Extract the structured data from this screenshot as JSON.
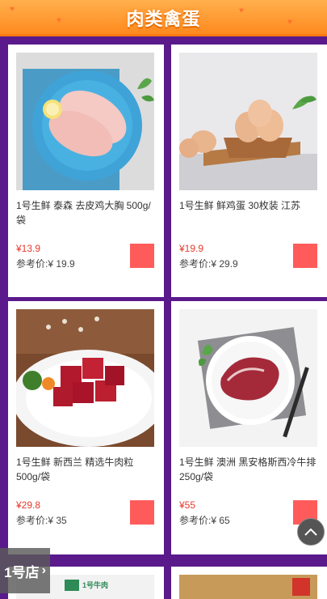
{
  "header": {
    "title": "肉类禽蛋"
  },
  "products": [
    {
      "name": "1号生鲜 泰森 去皮鸡大胸 500g/袋",
      "price": "¥13.9",
      "ref_price": "参考价:¥ 19.9",
      "image": "chicken-breast-image"
    },
    {
      "name": "1号生鲜 鲜鸡蛋 30枚装 江苏",
      "price": "¥19.9",
      "ref_price": "参考价:¥ 29.9",
      "image": "eggs-image"
    },
    {
      "name": "1号生鲜 新西兰 精选牛肉粒 500g/袋",
      "price": "¥29.8",
      "ref_price": "参考价:¥ 35",
      "image": "beef-cubes-image"
    },
    {
      "name": "1号生鲜 澳洲 黑安格斯西冷牛排 250g/袋",
      "price": "¥55",
      "ref_price": "参考价:¥ 65",
      "image": "sirloin-steak-image"
    }
  ],
  "bottom_thumbs": [
    {
      "label": "1号牛肉"
    },
    {
      "label": ""
    }
  ],
  "floating_logo": {
    "label": "1号店",
    "icon": "chevron-right-icon"
  },
  "colors": {
    "header": "#ff8a1f",
    "background": "#5a1a8c",
    "price": "#e43a2c",
    "cart_button": "#ff5b5b"
  }
}
